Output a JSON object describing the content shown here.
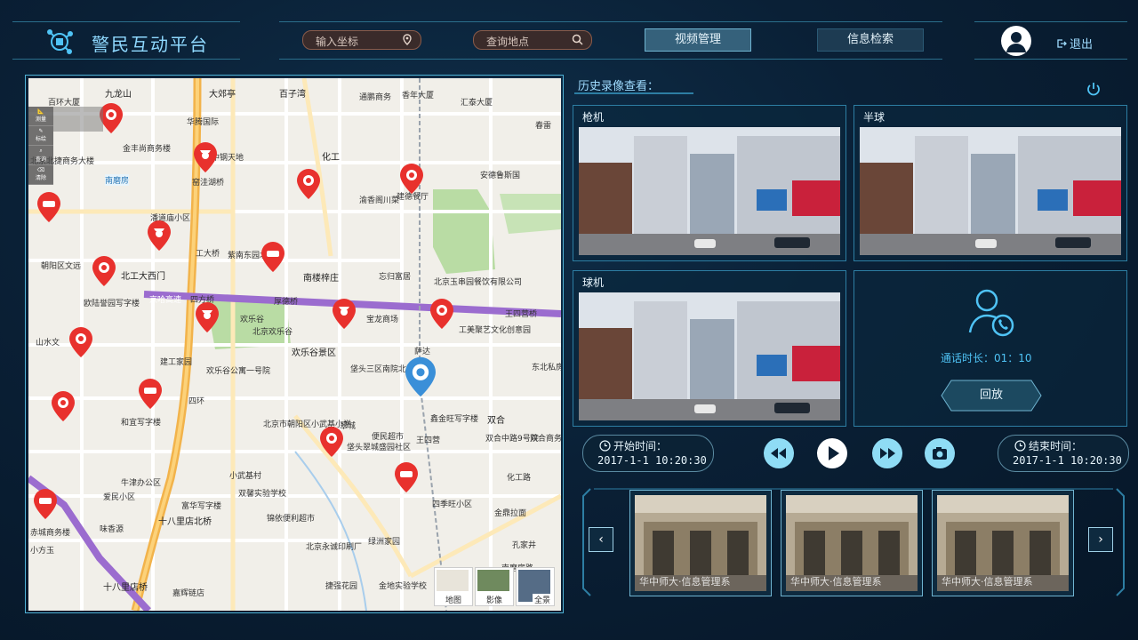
{
  "header": {
    "title": "警民互动平台",
    "coord_placeholder": "输入坐标",
    "place_placeholder": "查询地点",
    "tabs": [
      {
        "label": "视频管理",
        "active": true
      },
      {
        "label": "信息检索",
        "active": false
      }
    ],
    "logout": "退出"
  },
  "map": {
    "tools": [
      "测量",
      "标绘",
      "查询",
      "清除"
    ],
    "district_labels": [
      "百环大厦",
      "九龙山",
      "大郊亭",
      "百子湾",
      "通鹏商务",
      "香年大厦",
      "汇泰大厦",
      "春雷",
      "华腾国际",
      "金丰尚商务楼",
      "南磨房",
      "北京北捷商务大楼",
      "中钢天地",
      "化工",
      "安德鲁斯国",
      "窑洼湖桥",
      "渝香阁川菜",
      "建德餐厅",
      "潘道庙小区",
      "工大桥",
      "紫南东园北门",
      "南楼梓庄",
      "忘归富居",
      "北京玉串园餐饮有限公司",
      "朝阳区文远",
      "北工大西门",
      "京哈高速",
      "四方桥",
      "厚德桥",
      "王四营桥",
      "欧陆誉园写字楼",
      "欢乐谷",
      "北京欢乐谷",
      "宝龙商场",
      "工美聚艺文化创意园",
      "山水文",
      "建工家园",
      "欢乐谷景区",
      "垡头三区南院北区",
      "萨达",
      "东北私房",
      "欢乐谷公寓一号院",
      "和宜写字楼",
      "四环",
      "北京市朝阳区小武基小学",
      "翠城",
      "便民超市",
      "双合",
      "鑫金旺写字楼",
      "垡头翠城盛园社区",
      "王四营",
      "双合中路9号院",
      "双合商务中心",
      "牛津办公区",
      "小武基村",
      "化工路",
      "富华写字楼",
      "双馨实验学校",
      "锦依便利超市",
      "四季旺小区",
      "金鼎拉面",
      "爱民小区",
      "十八里店北桥",
      "北京永诚印刷厂",
      "味香源",
      "赤城商务楼",
      "小方玉",
      "绿洲家园",
      "孔家井",
      "十八里店桥",
      "嘉辉链店",
      "捷强花园",
      "金地实验学校",
      "南磨房路"
    ],
    "map_types": [
      "地图",
      "影像",
      "全景"
    ]
  },
  "history": {
    "title": "历史录像查看：",
    "cameras": [
      "枪机",
      "半球",
      "球机"
    ],
    "call_label": "通话时长：",
    "call_duration": "01：10",
    "replay": "回放",
    "start_label": "开始时间：",
    "start_time": "2017-1-1  10:20:30",
    "end_label": "结束时间：",
    "end_time": "2017-1-1  10:20:30",
    "thumb_watermark": "华中师大·信息管理系",
    "thumbs_count": 3
  },
  "colors": {
    "accent": "#4fc3f5",
    "pin_red": "#e8312d",
    "pin_blue": "#3a8fd8",
    "route_purple": "#9b6ccf",
    "road_orange": "#f2b34b"
  }
}
